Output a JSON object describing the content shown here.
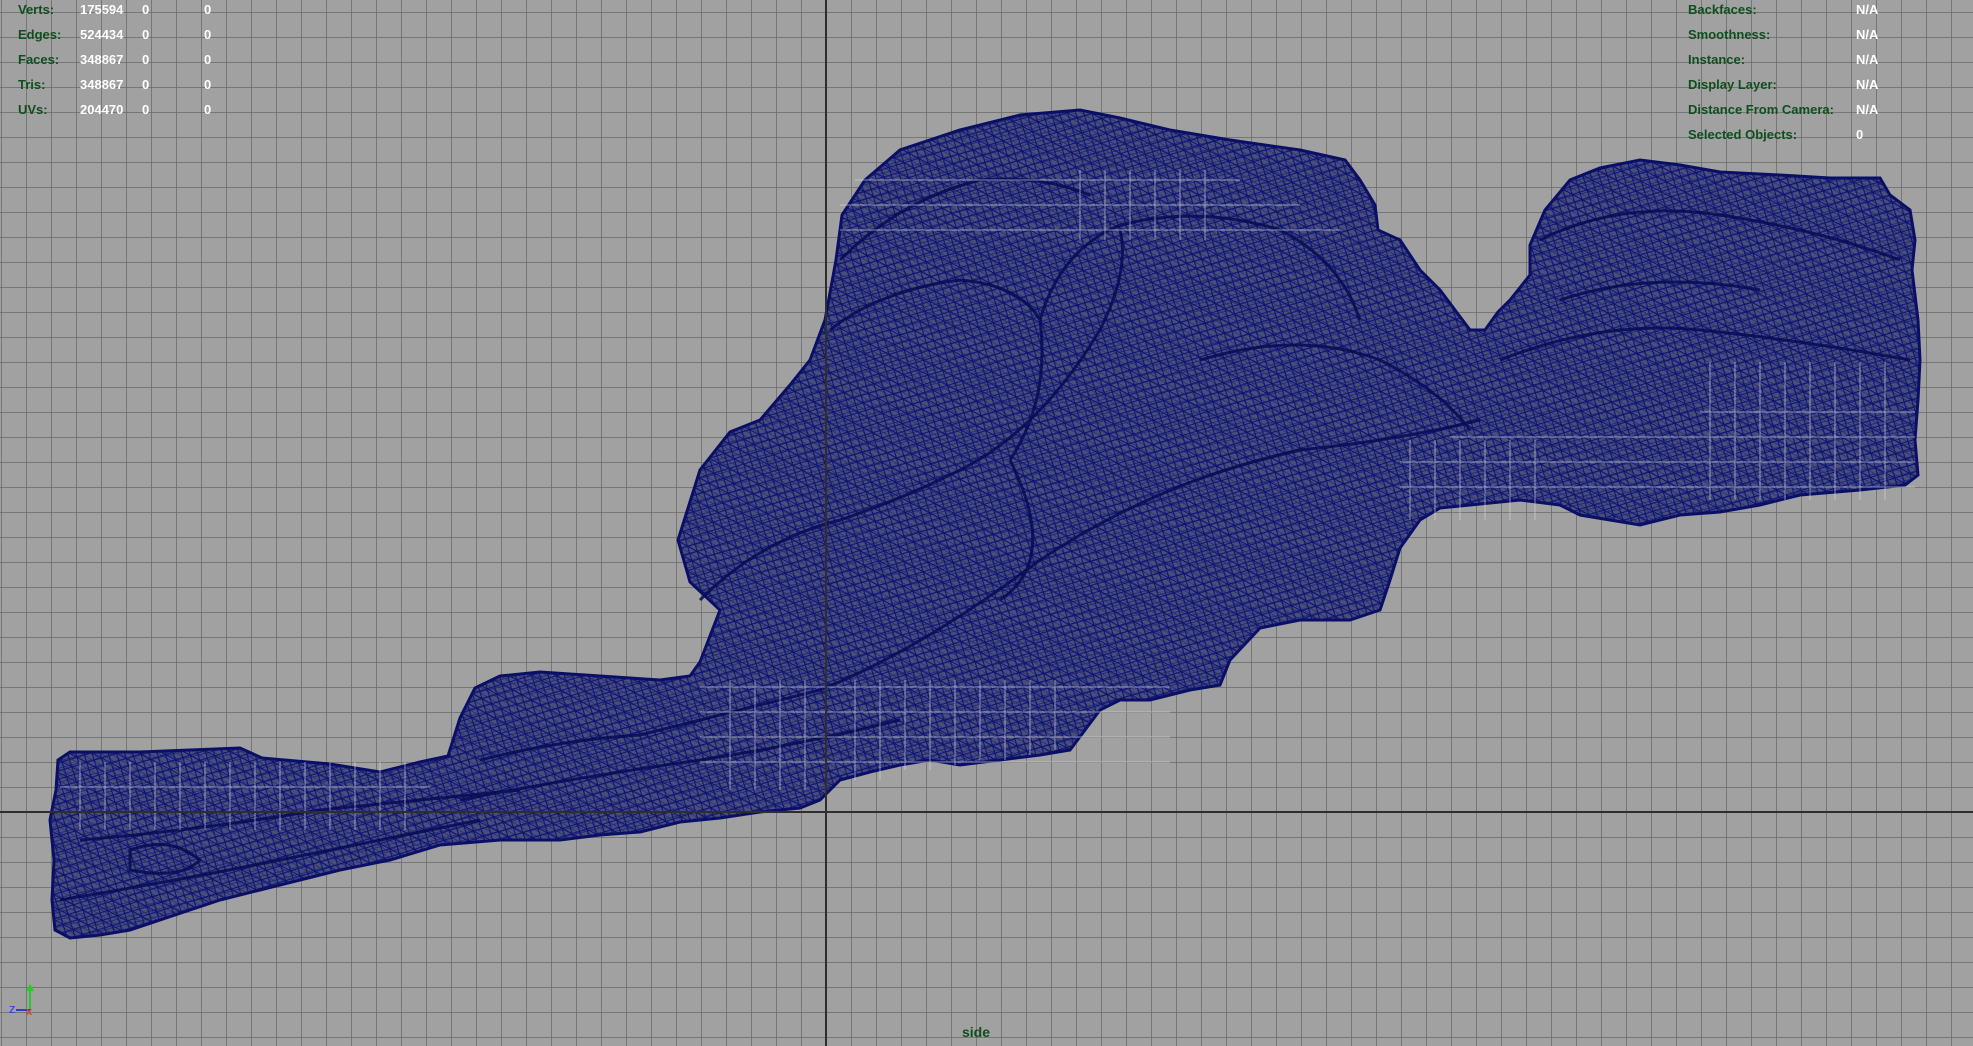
{
  "stats": {
    "rows": [
      {
        "label": "Verts:",
        "v1": "175594",
        "v2": "0",
        "v3": "0"
      },
      {
        "label": "Edges:",
        "v1": "524434",
        "v2": "0",
        "v3": "0"
      },
      {
        "label": "Faces:",
        "v1": "348867",
        "v2": "0",
        "v3": "0"
      },
      {
        "label": "Tris:",
        "v1": "348867",
        "v2": "0",
        "v3": "0"
      },
      {
        "label": "UVs:",
        "v1": "204470",
        "v2": "0",
        "v3": "0"
      }
    ]
  },
  "info": {
    "rows": [
      {
        "label": "Backfaces:",
        "value": "N/A"
      },
      {
        "label": "Smoothness:",
        "value": "N/A"
      },
      {
        "label": "Instance:",
        "value": "N/A"
      },
      {
        "label": "Display Layer:",
        "value": "N/A"
      },
      {
        "label": "Distance From Camera:",
        "value": "N/A"
      },
      {
        "label": "Selected Objects:",
        "value": "0"
      }
    ]
  },
  "view": {
    "camera_label": "side",
    "background_color": "#a1a1a1",
    "grid_color": "#696969",
    "axis_color": "#2e2e2e",
    "wireframe_color": "#0d1478",
    "hud_label_color": "#0f4f1f",
    "hud_value_color": "#ffffff"
  },
  "gizmo": {
    "z_label": "z",
    "y_color": "#22cc22",
    "z_color": "#2a3ed6",
    "x_color": "#d6452a"
  }
}
